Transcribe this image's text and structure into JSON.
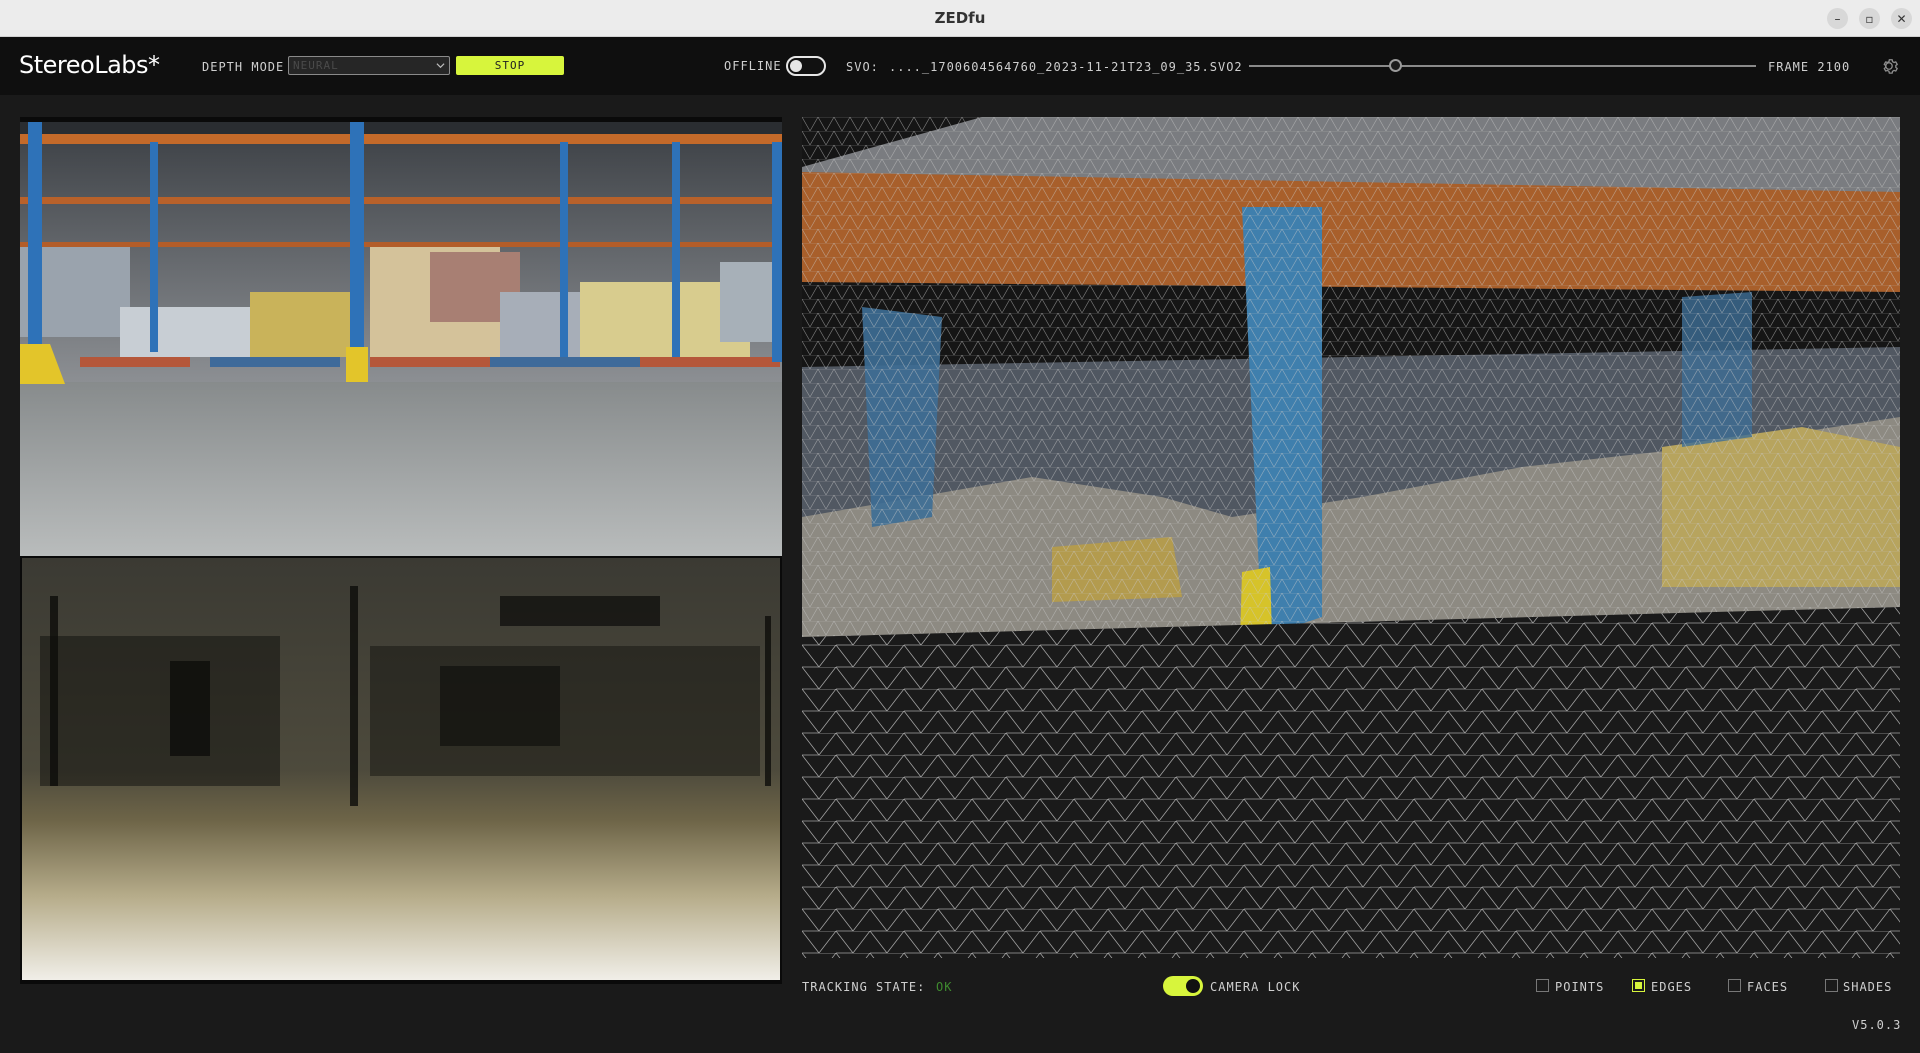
{
  "window": {
    "title": "ZEDfu"
  },
  "app": {
    "brand": "StereoLabs*",
    "depth_mode": {
      "label": "DEPTH MODE",
      "selected": "NEURAL"
    },
    "stop_label": "STOP",
    "offline_label": "OFFLINE",
    "offline_enabled": false,
    "svo": {
      "label": "SVO:",
      "path": "...._1700604564760_2023-11-21T23_09_35.SVO2",
      "playback_fraction": 0.29
    },
    "frame_label": "FRAME 2100"
  },
  "footer": {
    "tracking_label": "TRACKING STATE:",
    "tracking_value": "OK",
    "camera_lock_label": "CAMERA LOCK",
    "camera_lock_enabled": true,
    "options": [
      {
        "label": "POINTS",
        "checked": false
      },
      {
        "label": "EDGES",
        "checked": true
      },
      {
        "label": "FACES",
        "checked": false
      },
      {
        "label": "SHADES",
        "checked": false
      }
    ],
    "version": "V5.0.3"
  },
  "colors": {
    "accent": "#d7f53c",
    "background": "#1a1a1a",
    "header": "#0f0f0f",
    "status_ok": "#3f8a2f"
  }
}
